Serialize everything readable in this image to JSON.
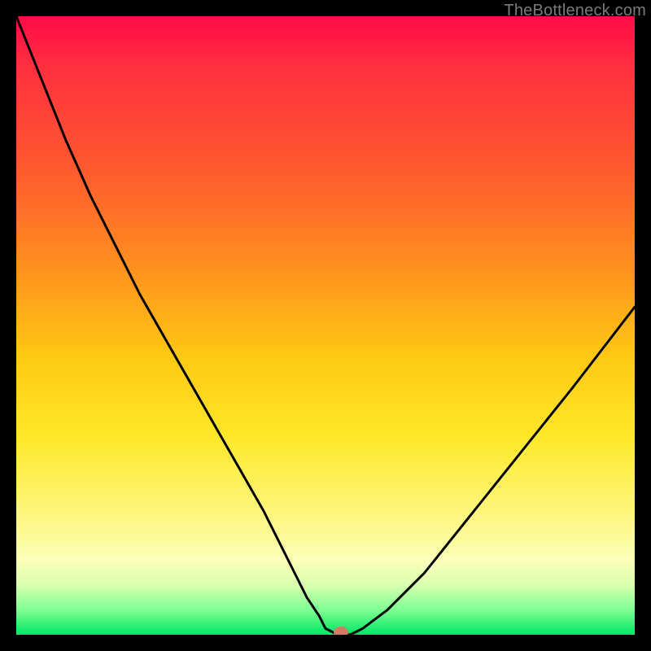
{
  "watermark": "TheBottleneck.com",
  "chart_data": {
    "type": "line",
    "title": "",
    "xlabel": "",
    "ylabel": "",
    "xlim": [
      0,
      100
    ],
    "ylim": [
      0,
      100
    ],
    "grid": false,
    "series": [
      {
        "name": "curve",
        "x": [
          0,
          4,
          8,
          12,
          16,
          20,
          24,
          28,
          32,
          36,
          40,
          43,
          45,
          47,
          49,
          50,
          52,
          54,
          56,
          60,
          66,
          74,
          82,
          90,
          100
        ],
        "y": [
          100,
          90,
          80,
          71,
          63,
          55,
          48,
          41,
          34,
          27,
          20,
          14,
          10,
          6,
          3,
          1,
          0,
          0,
          1,
          4,
          10,
          20,
          30,
          40,
          53
        ]
      }
    ],
    "marker": {
      "x": 52.5,
      "y": 0.4,
      "color": "#d77a63"
    },
    "background_gradient": {
      "top": "#ff0a4a",
      "mid1": "#ff8e1f",
      "mid2": "#ffe82a",
      "bottom": "#00e765"
    },
    "frame_color": "#000000"
  }
}
